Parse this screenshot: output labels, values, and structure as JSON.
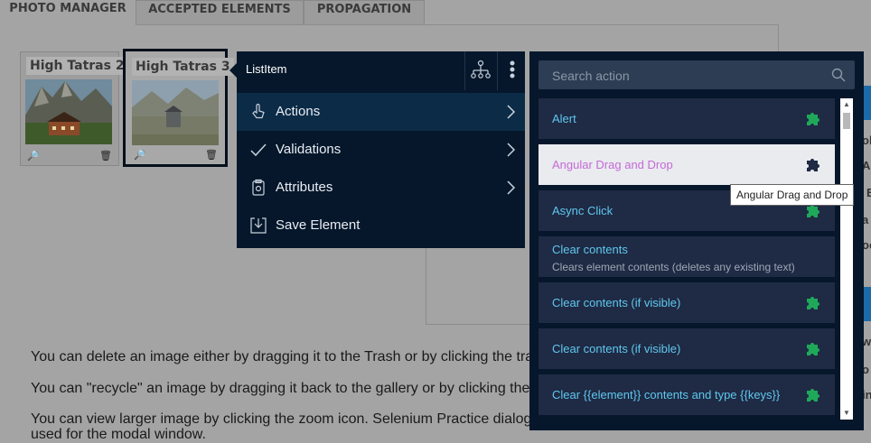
{
  "tabs": [
    "PHOTO MANAGER",
    "ACCEPTED ELEMENTS",
    "PROPAGATION"
  ],
  "gallery": [
    {
      "title": "High Tatras 2",
      "zoom_icon": "zoom-icon",
      "trash_icon": "trash-icon"
    },
    {
      "title": "High Tatras 3",
      "zoom_icon": "zoom-icon",
      "trash_icon": "trash-icon"
    }
  ],
  "paragraphs": [
    "You can delete an image either by dragging it to the Trash or by clicking the tra",
    "You can \"recycle\" an image by dragging it back to the gallery or by clicking the",
    "You can view larger image by clicking the zoom icon. Selenium Practice dialog",
    "used for the modal window."
  ],
  "context_menu": {
    "title": "ListItem",
    "tree_icon": "sitemap-icon",
    "more_icon": "kebab-icon",
    "items": [
      {
        "label": "Actions",
        "icon": "pointer-icon",
        "has_submenu": true,
        "highlighted": true
      },
      {
        "label": "Validations",
        "icon": "check-icon",
        "has_submenu": true,
        "highlighted": false
      },
      {
        "label": "Attributes",
        "icon": "clipboard-icon",
        "has_submenu": true,
        "highlighted": false
      },
      {
        "label": "Save Element",
        "icon": "save-icon",
        "has_submenu": false,
        "highlighted": false
      }
    ]
  },
  "action_panel": {
    "search_placeholder": "Search action",
    "search_icon": "search-icon",
    "rows": [
      {
        "title": "Alert",
        "description": "",
        "puzzle_icon": true,
        "selected": false
      },
      {
        "title": "Angular Drag and Drop",
        "description": "",
        "puzzle_icon": true,
        "selected": true
      },
      {
        "title": "Async Click",
        "description": "",
        "puzzle_icon": true,
        "selected": false
      },
      {
        "title": "Clear contents",
        "description": "Clears element contents (deletes any existing text)",
        "puzzle_icon": false,
        "selected": false
      },
      {
        "title": "Clear contents (if visible)",
        "description": "",
        "puzzle_icon": true,
        "selected": false
      },
      {
        "title": "Clear contents (if visible)",
        "description": "",
        "puzzle_icon": true,
        "selected": false
      },
      {
        "title": "Clear {{element}} contents and type {{keys}}",
        "description": "",
        "puzzle_icon": true,
        "selected": false
      }
    ],
    "tooltip": "Angular Drag and Drop"
  },
  "edge_letters": [
    "A",
    "ol",
    "Ar",
    "E",
    "a",
    "oc",
    "T",
    "w",
    "o",
    "in"
  ],
  "colors": {
    "menu_bg": "#06172b",
    "row_bg": "#1f2a44",
    "row_text": "#5fc8ef",
    "selected_text": "#c56ad6",
    "puzzle_green": "#1fa85a"
  }
}
